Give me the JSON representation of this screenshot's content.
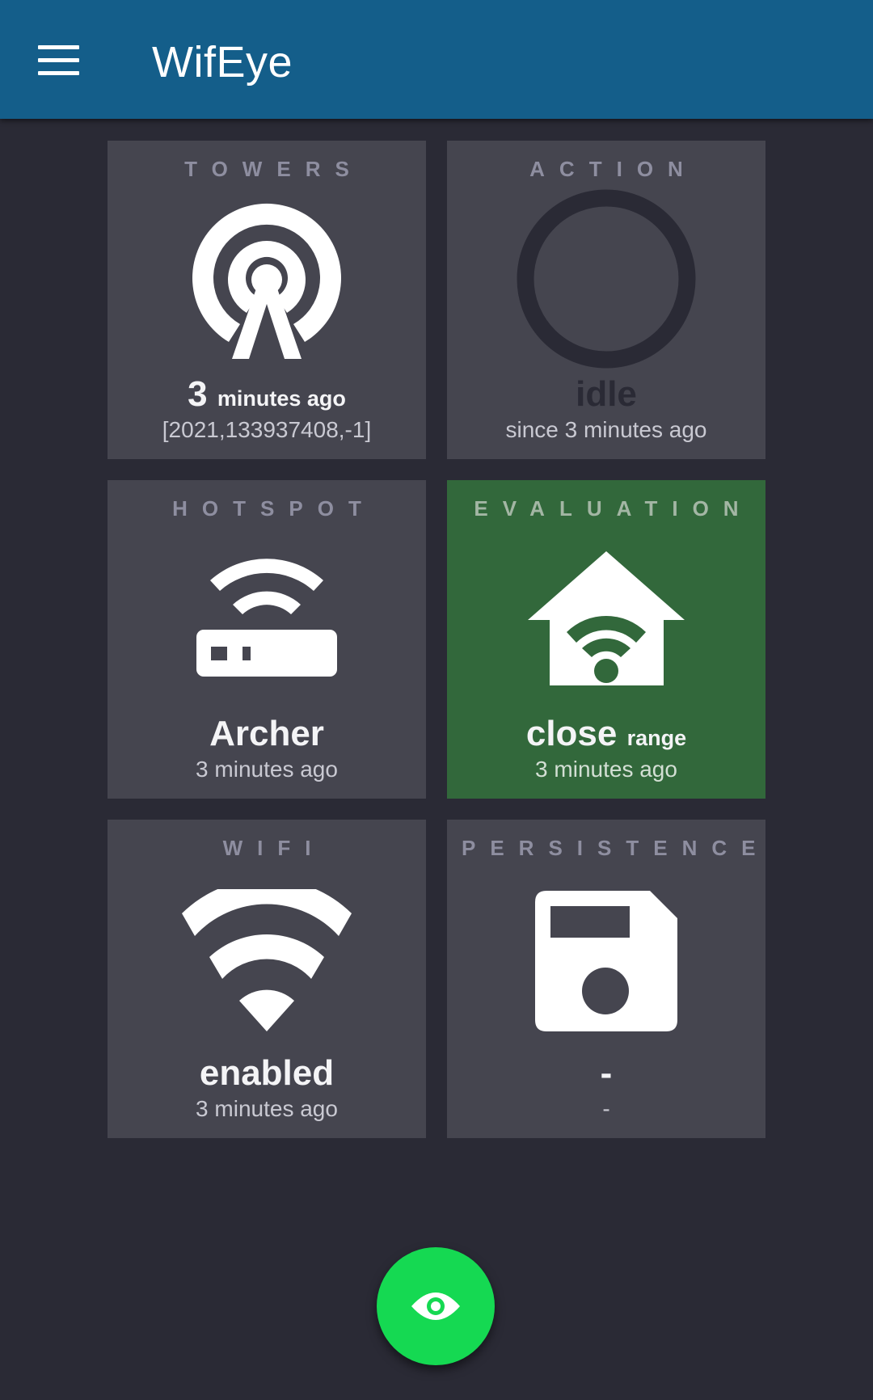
{
  "app": {
    "title": "WifEye"
  },
  "tiles": {
    "towers": {
      "label": "TOWERS",
      "main_number": "3",
      "main_unit": "minutes ago",
      "sub": "[2021,133937408,-1]",
      "icon": "antenna-icon"
    },
    "action": {
      "label": "ACTION",
      "main": "idle",
      "sub": "since 3 minutes ago",
      "icon": "ring-icon"
    },
    "hotspot": {
      "label": "HOTSPOT",
      "main": "Archer",
      "sub": "3 minutes ago",
      "icon": "router-icon"
    },
    "evaluation": {
      "label": "EVALUATION",
      "main_word": "close",
      "main_unit": "range",
      "sub": "3 minutes ago",
      "icon": "home-wifi-icon",
      "color": "#32683b"
    },
    "wifi": {
      "label": "WIFI",
      "main": "enabled",
      "sub": "3 minutes ago",
      "icon": "wifi-icon"
    },
    "persistence": {
      "label": "PERSISTENCE",
      "main": "-",
      "sub": "-",
      "icon": "floppy-disk-icon"
    }
  },
  "colors": {
    "appbar": "#145e8a",
    "background": "#2a2a35",
    "tile": "#45454f",
    "fab": "#15d952"
  },
  "fab": {
    "icon": "eye-icon"
  }
}
